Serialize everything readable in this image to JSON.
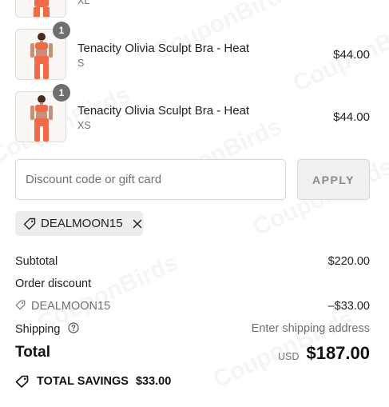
{
  "cart": {
    "top_item": {
      "variant": "XL"
    },
    "items": [
      {
        "quantity": "1",
        "name": "Tenacity Olivia Sculpt Bra - Heat",
        "variant": "S",
        "price": "$44.00"
      },
      {
        "quantity": "1",
        "name": "Tenacity Olivia Sculpt Bra - Heat",
        "variant": "XS",
        "price": "$44.00"
      }
    ]
  },
  "discount": {
    "placeholder": "Discount code or gift card",
    "apply_label": "APPLY",
    "applied_code": "DEALMOON15"
  },
  "summary": {
    "subtotal_label": "Subtotal",
    "subtotal_value": "$220.00",
    "order_discount_label": "Order discount",
    "discount_code": "DEALMOON15",
    "discount_value": "–$33.00",
    "shipping_label": "Shipping",
    "shipping_value": "Enter shipping address",
    "total_label": "Total",
    "currency": "USD",
    "total_value": "$187.00",
    "savings_label": "TOTAL SAVINGS",
    "savings_value": "$33.00"
  },
  "watermark": "CouponBirds",
  "colors": {
    "product": "#f06a48",
    "badge": "#6e6e6e",
    "muted": "#707070"
  }
}
